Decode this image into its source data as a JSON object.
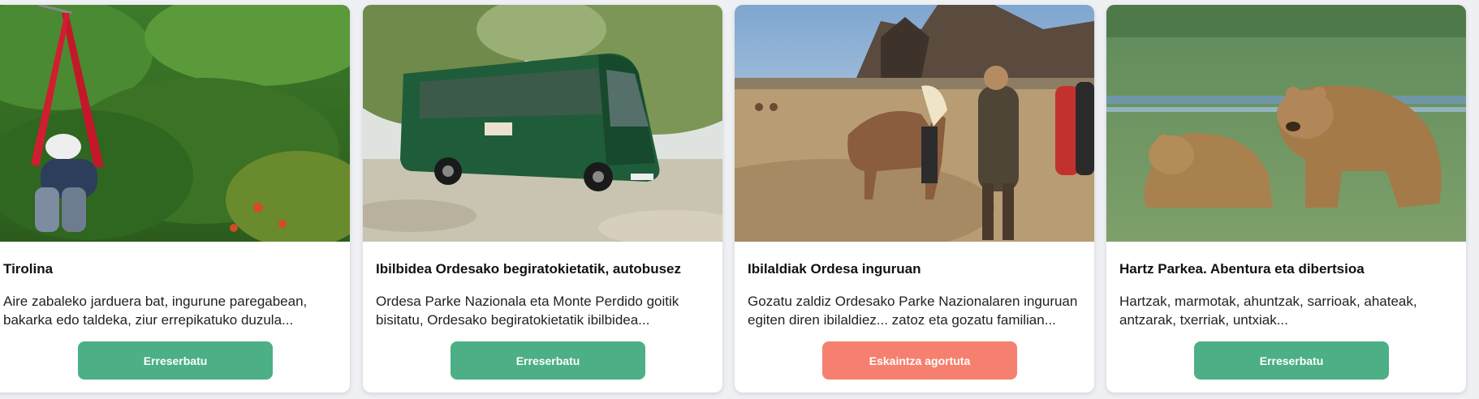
{
  "cards": [
    {
      "title": "Tirolina",
      "description": "Aire zabaleko jarduera bat, ingurune paregabean, bakarka edo taldeka, ziur errepikatuko duzula...",
      "button_label": "Erreserbatu",
      "button_state": "available",
      "image": "zipline-photo"
    },
    {
      "title": "Ibilbidea Ordesako begiratokietatik, autobusez",
      "description": "Ordesa Parke Nazionala eta Monte Perdido goitik bisitatu, Ordesako begiratokietatik ibilbidea...",
      "button_label": "Erreserbatu",
      "button_state": "available",
      "image": "green-bus-photo"
    },
    {
      "title": "Ibilaldiak Ordesa inguruan",
      "description": "Gozatu zaldiz Ordesako Parke Nazionalaren inguruan egiten diren ibilaldiez... zatoz eta gozatu familian...",
      "button_label": "Eskaintza agortuta",
      "button_state": "sold-out",
      "image": "horses-photo"
    },
    {
      "title": "Hartz Parkea. Abentura eta dibertsioa",
      "description": "Hartzak, marmotak, ahuntzak, sarrioak, ahateak, antzarak, txerriak, untxiak...",
      "button_label": "Erreserbatu",
      "button_state": "available",
      "image": "bears-photo"
    }
  ],
  "colors": {
    "available": "#4caf85",
    "sold_out": "#f6806f"
  }
}
